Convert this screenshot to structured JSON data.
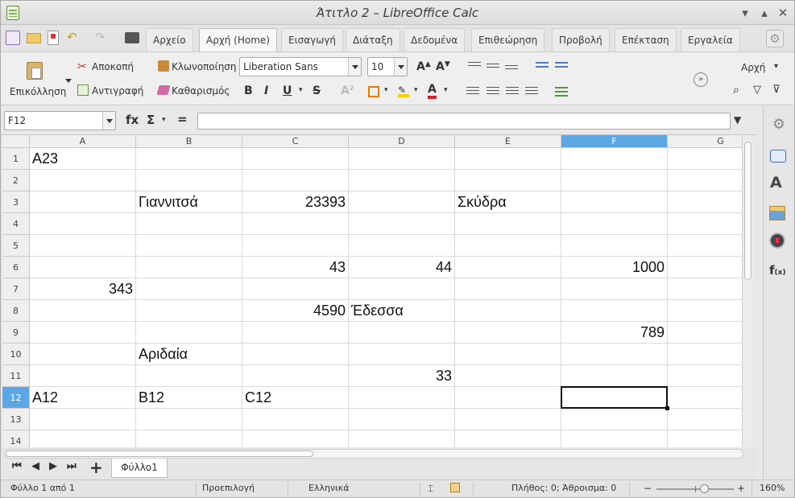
{
  "window": {
    "title": "Άτιτλο 2 – LibreOffice Calc"
  },
  "menu_tabs": [
    "Αρχείο",
    "Αρχή (Home)",
    "Εισαγωγή",
    "Διάταξη",
    "Δεδομένα",
    "Επιθεώρηση",
    "Προβολή",
    "Επέκταση",
    "Εργαλεία"
  ],
  "active_tab": "Αρχή (Home)",
  "toolbar": {
    "paste": "Επικόλληση",
    "cut": "Αποκοπή",
    "copy": "Αντιγραφή",
    "clone": "Κλωνοποίηση",
    "clear": "Καθαρισμός",
    "font_name": "Liberation Sans",
    "font_size": "10",
    "styles": "Αρχή"
  },
  "formula_bar": {
    "name_box": "F12",
    "fx": "fx",
    "sum": "Σ",
    "equals": "=",
    "content": ""
  },
  "columns": [
    "A",
    "B",
    "C",
    "D",
    "E",
    "F",
    "G"
  ],
  "selected_column": "F",
  "selected_row": "12",
  "rows": [
    "1",
    "2",
    "3",
    "4",
    "5",
    "6",
    "7",
    "8",
    "9",
    "10",
    "11",
    "12",
    "13",
    "14"
  ],
  "cells": {
    "A1": "A23",
    "B3": "Γιαννιτσά",
    "C3": "23393",
    "E3": "Σκύδρα",
    "C6": "43",
    "D6": "44",
    "F6": "1000",
    "A7": "343",
    "C8": "4590",
    "D8": "Έδεσσα",
    "F9": "789",
    "B10": "Αριδαία",
    "D11": "33",
    "A12": "A12",
    "B12": "B12",
    "C12": "C12"
  },
  "sheet_tab": "Φύλλο1",
  "status": {
    "sheet": "Φύλλο 1 από 1",
    "page_style": "Προεπιλογή",
    "language": "Ελληνικά",
    "stats": "Πλήθος: 0; Άθροισμα: 0",
    "zoom": "160%"
  }
}
